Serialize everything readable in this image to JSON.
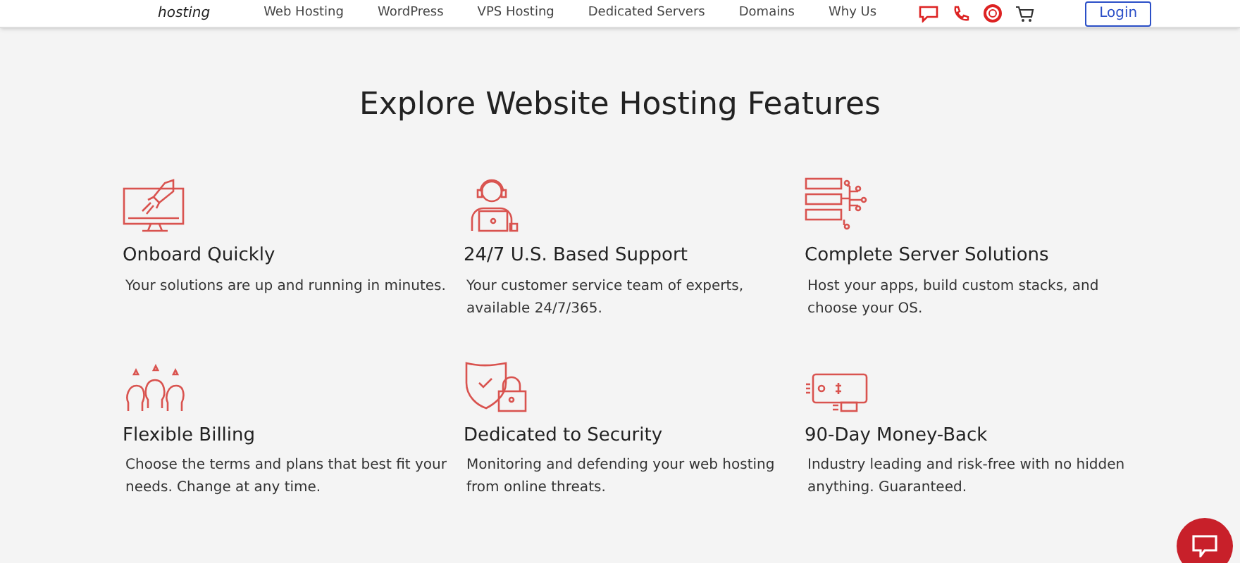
{
  "header": {
    "logo_text": "hosting",
    "nav": [
      "Web Hosting",
      "WordPress",
      "VPS Hosting",
      "Dedicated Servers",
      "Domains",
      "Why Us"
    ],
    "login": "Login"
  },
  "section": {
    "title": "Explore Website Hosting Features",
    "features": [
      {
        "kind": "rocket",
        "title": "Onboard Quickly",
        "text": "Your solutions are up and running in minutes."
      },
      {
        "kind": "support",
        "title": "24/7 U.S. Based Support",
        "text": "Your customer service team of experts, available 24/7/365."
      },
      {
        "kind": "servers",
        "title": "Complete Server Solutions",
        "text": "Host your apps, build custom stacks, and choose your OS."
      },
      {
        "kind": "billing",
        "title": "Flexible Billing",
        "text": "Choose the terms and plans that best fit your needs. Change at any time."
      },
      {
        "kind": "security",
        "title": "Dedicated to Security",
        "text": "Monitoring and defending your web hosting from online threats."
      },
      {
        "kind": "money",
        "title": "90-Day Money-Back",
        "text": "Industry leading and risk-free with no hidden anything. Guaranteed."
      }
    ]
  }
}
